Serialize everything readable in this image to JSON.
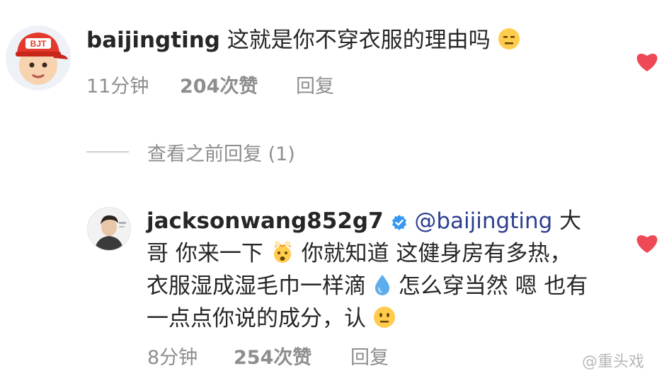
{
  "comment": {
    "username": "baijingting",
    "text": "这就是你不穿衣服的理由吗",
    "emoji": "expressionless-face",
    "avatar_badge": "BJT",
    "time": "11分钟",
    "likes": "204次赞",
    "reply_label": "回复"
  },
  "view_replies": {
    "label": "查看之前回复 (1)"
  },
  "reply": {
    "username": "jacksonwang852g7",
    "verified_icon": "verified-badge",
    "mention": "@baijingting",
    "text_part1": "大哥 你来一下",
    "text_part2": "你就知道 这健身房有多热，衣服湿成湿毛巾一样滴",
    "text_part3": "怎么穿当然 嗯 也有 一点点你说的成分，认",
    "emojis": [
      "exploding-head",
      "droplet",
      "neutral-face"
    ],
    "time": "8分钟",
    "likes": "254次赞",
    "reply_label": "回复"
  },
  "watermark": "@重头戏",
  "colors": {
    "heart": "#ed4956",
    "mention": "#2d3f8f",
    "verified": "#3897f0",
    "meta_text": "#8e8e8e"
  }
}
